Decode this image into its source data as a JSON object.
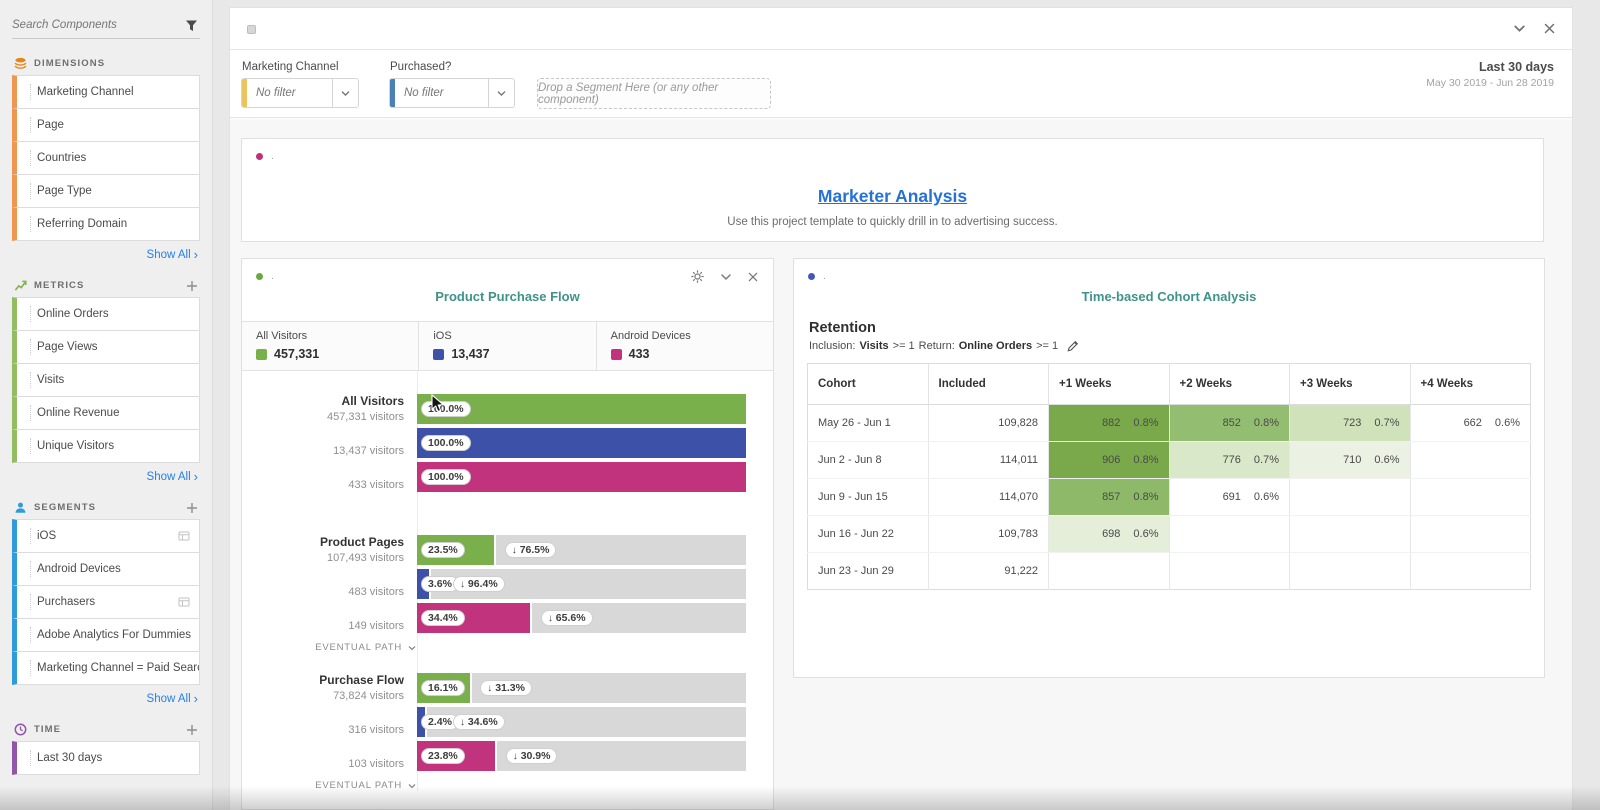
{
  "sidebar": {
    "search_placeholder": "Search Components",
    "show_all_label": "Show All",
    "sections": [
      {
        "id": "dimensions",
        "label": "DIMENSIONS",
        "color": "#e68619",
        "rail": "#ef9651",
        "has_add": false,
        "show_all": true,
        "items": [
          {
            "label": "Marketing Channel"
          },
          {
            "label": "Page"
          },
          {
            "label": "Countries"
          },
          {
            "label": "Page Type"
          },
          {
            "label": "Referring Domain"
          }
        ]
      },
      {
        "id": "metrics",
        "label": "METRICS",
        "color": "#84b152",
        "rail": "#93bd62",
        "has_add": true,
        "show_all": true,
        "items": [
          {
            "label": "Online Orders"
          },
          {
            "label": "Page Views"
          },
          {
            "label": "Visits"
          },
          {
            "label": "Online Revenue"
          },
          {
            "label": "Unique Visitors"
          }
        ]
      },
      {
        "id": "segments",
        "label": "SEGMENTS",
        "color": "#2f9bd8",
        "rail": "#2f9bd8",
        "has_add": true,
        "show_all": true,
        "items": [
          {
            "label": "iOS",
            "badge": true
          },
          {
            "label": "Android Devices"
          },
          {
            "label": "Purchasers",
            "badge": true
          },
          {
            "label": "Adobe Analytics For Dummies"
          },
          {
            "label": "Marketing Channel = Paid Search"
          }
        ]
      },
      {
        "id": "time",
        "label": "TIME",
        "color": "#9256a8",
        "rail": "#9256a8",
        "has_add": true,
        "show_all": false,
        "items": [
          {
            "label": "Last 30 days"
          }
        ]
      }
    ]
  },
  "filters": {
    "filter1_label": "Marketing Channel",
    "filter1_value": "No filter",
    "filter1_rail": "#eac45e",
    "filter2_label": "Purchased?",
    "filter2_value": "No filter",
    "filter2_rail": "#4b80b4",
    "dropzone_text": "Drop a Segment Here (or any other component)",
    "range_label": "Last 30 days",
    "range_dates": "May 30 2019 - Jun 28 2019"
  },
  "description": {
    "panel_label": ".",
    "dot_color": "#c0307c",
    "title": "Marketer Analysis",
    "subtitle": "Use this project template to quickly drill in to advertising success."
  },
  "chart_data": [
    {
      "type": "funnel",
      "panel_label": ".",
      "dot_color": "#69a83e",
      "title": "Product Purchase Flow",
      "eventual_path_label": "EVENTUAL PATH",
      "legend": [
        {
          "name": "All Visitors",
          "value": "457,331",
          "color": "#7ab04c"
        },
        {
          "name": "iOS",
          "value": "13,437",
          "color": "#3e51a8"
        },
        {
          "name": "Android Devices",
          "value": "433",
          "color": "#c1337c"
        }
      ],
      "steps": [
        {
          "name": "All Visitors",
          "eventual_path": false,
          "rows": [
            {
              "visitors": "457,331 visitors",
              "pct": 100.0,
              "pct_label": "100.0%",
              "fallout_label": null
            },
            {
              "visitors": "13,437 visitors",
              "pct": 100.0,
              "pct_label": "100.0%",
              "fallout_label": null
            },
            {
              "visitors": "433 visitors",
              "pct": 100.0,
              "pct_label": "100.0%",
              "fallout_label": null
            }
          ]
        },
        {
          "name": "Product Pages",
          "eventual_path": true,
          "rows": [
            {
              "visitors": "107,493 visitors",
              "pct": 23.5,
              "pct_label": "23.5%",
              "fallout_label": "76.5%"
            },
            {
              "visitors": "483 visitors",
              "pct": 3.6,
              "pct_label": "3.6%",
              "fallout_label": "96.4%"
            },
            {
              "visitors": "149 visitors",
              "pct": 34.4,
              "pct_label": "34.4%",
              "fallout_label": "65.6%"
            }
          ]
        },
        {
          "name": "Purchase Flow",
          "eventual_path": true,
          "rows": [
            {
              "visitors": "73,824 visitors",
              "pct": 16.1,
              "pct_label": "16.1%",
              "fallout_label": "31.3%"
            },
            {
              "visitors": "316 visitors",
              "pct": 2.4,
              "pct_label": "2.4%",
              "fallout_label": "34.6%"
            },
            {
              "visitors": "103 visitors",
              "pct": 23.8,
              "pct_label": "23.8%",
              "fallout_label": "30.9%"
            }
          ]
        }
      ]
    },
    {
      "type": "table",
      "panel_label": ".",
      "dot_color": "#4556b8",
      "title": "Time-based Cohort Analysis",
      "subtitle": "Retention",
      "criteria": {
        "inclusion_label": "Inclusion:",
        "inclusion_metric": "Visits",
        "inclusion_cond": ">= 1",
        "return_label": "Return:",
        "return_metric": "Online Orders",
        "return_cond": ">= 1"
      },
      "columns": [
        "Cohort",
        "Included",
        "+1 Weeks",
        "+2 Weeks",
        "+3 Weeks",
        "+4 Weeks"
      ],
      "rows": [
        {
          "cohort": "May 26 - Jun 1",
          "included": "109,828",
          "cells": [
            {
              "count": "882",
              "pct": "0.8%",
              "bg": "#7aa94b"
            },
            {
              "count": "852",
              "pct": "0.8%",
              "bg": "#93bd70"
            },
            {
              "count": "723",
              "pct": "0.7%",
              "bg": "#cfe2ba"
            },
            {
              "count": "662",
              "pct": "0.6%",
              "bg": null
            }
          ]
        },
        {
          "cohort": "Jun 2 - Jun 8",
          "included": "114,011",
          "cells": [
            {
              "count": "906",
              "pct": "0.8%",
              "bg": "#7aa94b"
            },
            {
              "count": "776",
              "pct": "0.7%",
              "bg": "#d9e8c8"
            },
            {
              "count": "710",
              "pct": "0.6%",
              "bg": "#ebf2e3"
            },
            null
          ]
        },
        {
          "cohort": "Jun 9 - Jun 15",
          "included": "114,070",
          "cells": [
            {
              "count": "857",
              "pct": "0.8%",
              "bg": "#8db968"
            },
            {
              "count": "691",
              "pct": "0.6%",
              "bg": null
            },
            null,
            null
          ]
        },
        {
          "cohort": "Jun 16 - Jun 22",
          "included": "109,783",
          "cells": [
            {
              "count": "698",
              "pct": "0.6%",
              "bg": "#e4eed8"
            },
            null,
            null,
            null
          ]
        },
        {
          "cohort": "Jun 23 - Jun 29",
          "included": "91,222",
          "cells": [
            null,
            null,
            null,
            null
          ]
        }
      ]
    }
  ]
}
